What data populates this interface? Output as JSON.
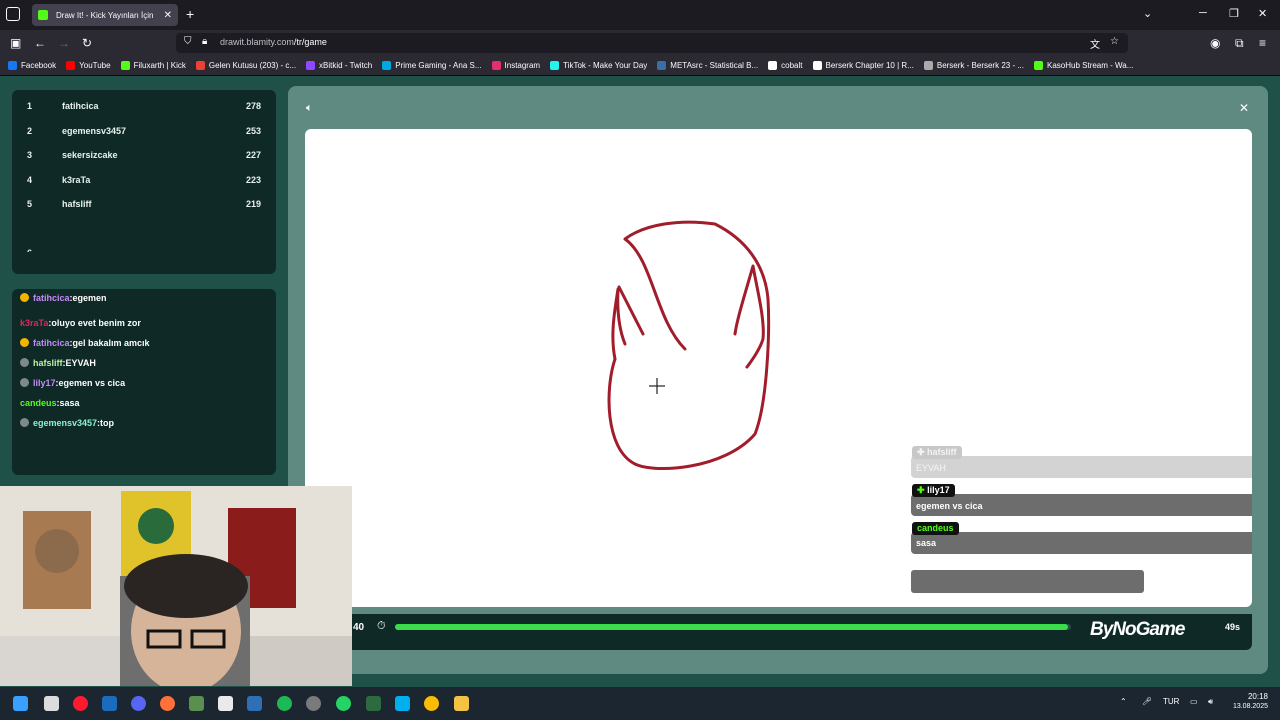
{
  "browser": {
    "tab_title": "Draw It! - Kick Yayınları İçin",
    "tab_close": "✕",
    "new_tab": "+",
    "url_host": "drawit.blamity.com",
    "url_path": "/tr/game",
    "window_controls": [
      "─",
      "❐",
      "✕"
    ],
    "bookmarks": [
      {
        "label": "Facebook",
        "color": "#1877f2"
      },
      {
        "label": "YouTube",
        "color": "#ff0000"
      },
      {
        "label": "Filuxarth | Kick",
        "color": "#53fc18"
      },
      {
        "label": "Gelen Kutusu (203) - c...",
        "color": "#ea4335"
      },
      {
        "label": "xBitkid - Twitch",
        "color": "#9146ff"
      },
      {
        "label": "Prime Gaming - Ana S...",
        "color": "#00a8e1"
      },
      {
        "label": "Instagram",
        "color": "#e1306c"
      },
      {
        "label": "TikTok - Make Your Day",
        "color": "#25f4ee"
      },
      {
        "label": "METAsrc - Statistical B...",
        "color": "#3a6ea5"
      },
      {
        "label": "cobalt",
        "color": "#ffffff"
      },
      {
        "label": "Berserk Chapter 10 | R...",
        "color": "#ffffff"
      },
      {
        "label": "Berserk - Berserk 23 - ...",
        "color": "#aaaaaa"
      },
      {
        "label": "KasoHub Stream - Wa...",
        "color": "#53fc18"
      }
    ]
  },
  "leaderboard": [
    {
      "rank": "1",
      "name": "fatihcica",
      "score": "278"
    },
    {
      "rank": "2",
      "name": "egemensv3457",
      "score": "253"
    },
    {
      "rank": "3",
      "name": "sekersizcake",
      "score": "227"
    },
    {
      "rank": "4",
      "name": "k3raTa",
      "score": "223"
    },
    {
      "rank": "5",
      "name": "hafsliff",
      "score": "219"
    }
  ],
  "chat": [
    {
      "user": "fatihcica",
      "text": ":egemen",
      "color": "#c58af9",
      "badge": "#f5b400"
    },
    {
      "user": "k3raTa",
      "text": ":oluyo evet benim zor",
      "color": "#e0245e",
      "badge": ""
    },
    {
      "user": "fatihcica",
      "text": ":gel bakalım amcık",
      "color": "#c58af9",
      "badge": "#f5b400"
    },
    {
      "user": "hafsliff",
      "text": ":EYVAH",
      "color": "#b8f5a0",
      "badge": "#7c8a88"
    },
    {
      "user": "lily17",
      "text": ":egemen vs cica",
      "color": "#c58af9",
      "badge": "#7c8a88"
    },
    {
      "user": "candeus",
      "text": ":sasa",
      "color": "#53fc18",
      "badge": ""
    },
    {
      "user": "egemensv3457",
      "text": ":top",
      "color": "#8ef0d0",
      "badge": "#7c8a88"
    }
  ],
  "overlay_guesses": [
    {
      "user": "hafsliff",
      "text": "EYVAH",
      "faded": true
    },
    {
      "user": "lily17",
      "text": "egemen vs cica",
      "faded": false
    },
    {
      "user": "candeus",
      "text": "sasa",
      "faded": false
    }
  ],
  "timer": {
    "left_value": "40",
    "right_value": "49s",
    "progress": 0.996,
    "brand": "ByNoGame"
  },
  "colors": {
    "page_bg": "#1f5149",
    "panel_bg": "#0f2a26",
    "progress": "#3bdc4c",
    "stroke": "#a11d2c"
  },
  "taskbar": {
    "time": "20:18",
    "date": "13.08.2025",
    "lang": "TUR"
  }
}
